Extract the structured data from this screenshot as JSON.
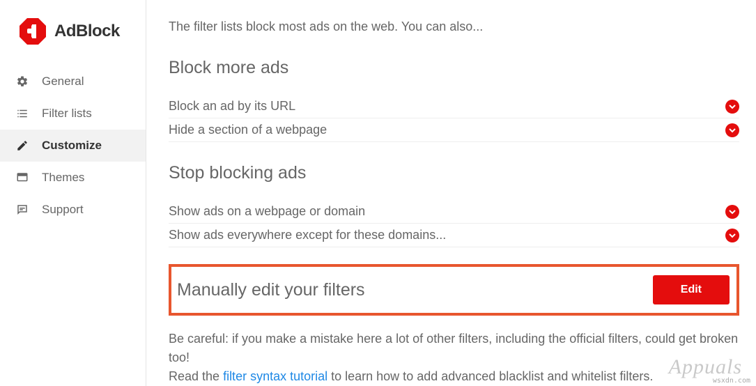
{
  "brand": {
    "name": "AdBlock"
  },
  "sidebar": {
    "items": [
      {
        "label": "General",
        "icon": "gear-icon"
      },
      {
        "label": "Filter lists",
        "icon": "list-icon"
      },
      {
        "label": "Customize",
        "icon": "pencil-icon"
      },
      {
        "label": "Themes",
        "icon": "theme-icon"
      },
      {
        "label": "Support",
        "icon": "chat-icon"
      }
    ],
    "activeIndex": 2
  },
  "main": {
    "intro": "The filter lists block most ads on the web. You can also...",
    "blockMore": {
      "heading": "Block more ads",
      "rows": [
        {
          "label": "Block an ad by its URL"
        },
        {
          "label": "Hide a section of a webpage"
        }
      ]
    },
    "stopBlocking": {
      "heading": "Stop blocking ads",
      "rows": [
        {
          "label": "Show ads on a webpage or domain"
        },
        {
          "label": "Show ads everywhere except for these domains..."
        }
      ]
    },
    "manualEdit": {
      "heading": "Manually edit your filters",
      "editBtn": "Edit"
    },
    "warning": {
      "line1": "Be careful: if you make a mistake here a lot of other filters, including the official filters, could get broken too!",
      "line2_pre": "Read the ",
      "line2_link": "filter syntax tutorial",
      "line2_post": " to learn how to add advanced blacklist and whitelist filters."
    }
  },
  "watermark": "wsxdn.com",
  "appuals": "Appuals"
}
